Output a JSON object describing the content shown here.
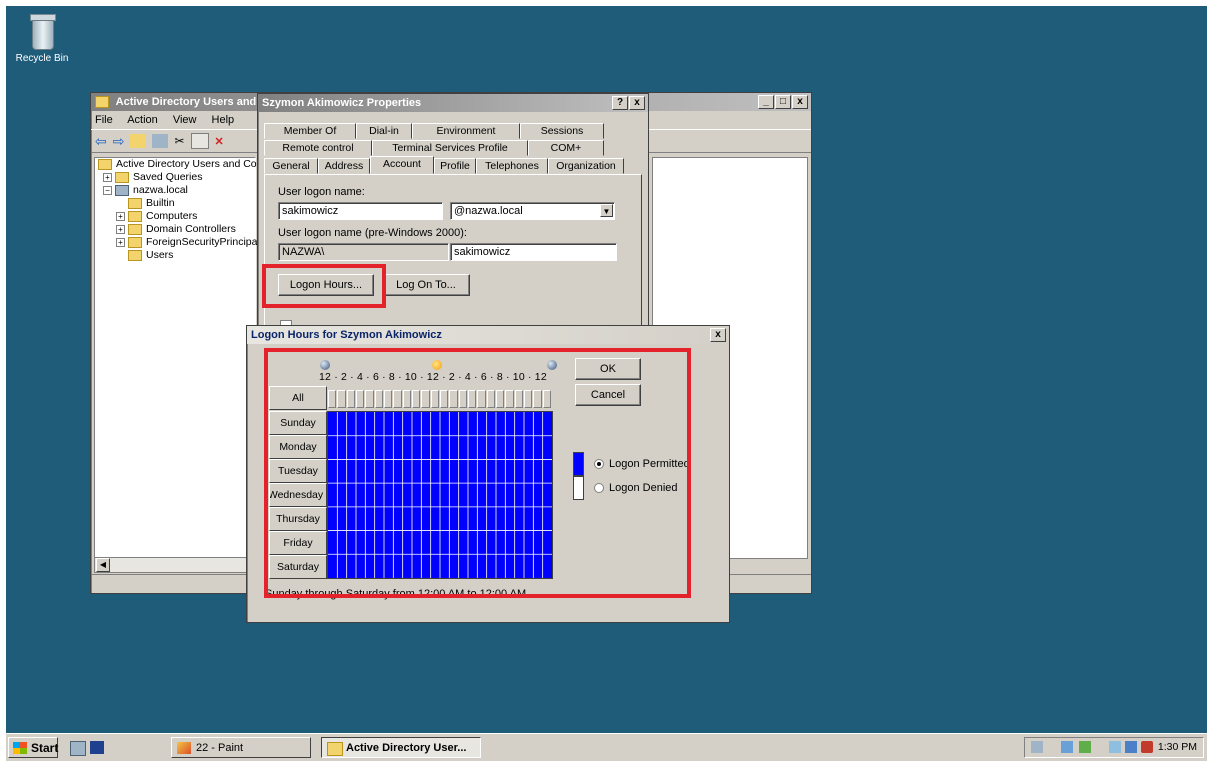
{
  "desktop": {
    "recycle_bin_label": "Recycle Bin",
    "background": "#1e5c7a"
  },
  "aduc": {
    "title": "Active Directory Users and",
    "menu": [
      "File",
      "Action",
      "View",
      "Help"
    ],
    "tree": {
      "root": "Active Directory Users and Cor",
      "saved_queries": "Saved Queries",
      "domain": "nazwa.local",
      "builtin": "Builtin",
      "computers": "Computers",
      "domain_controllers": "Domain Controllers",
      "foreign": "ForeignSecurityPrincipa",
      "users": "Users"
    }
  },
  "props": {
    "title": "Szymon Akimowicz Properties",
    "tabs_row1": [
      "Member Of",
      "Dial-in",
      "Environment",
      "Sessions"
    ],
    "tabs_row2": [
      "Remote control",
      "Terminal Services Profile",
      "COM+"
    ],
    "tabs_row3": [
      "General",
      "Address",
      "Account",
      "Profile",
      "Telephones",
      "Organization"
    ],
    "active_tab": "Account",
    "logon_name_label": "User logon name:",
    "logon_name_value": "sakimowicz",
    "domain_suffix": "@nazwa.local",
    "prewin_label": "User logon name (pre-Windows 2000):",
    "prewin_domain": "NAZWA\\",
    "prewin_user": "sakimowicz",
    "logon_hours_button": "Logon Hours...",
    "logon_to_button": "Log On To..."
  },
  "hours": {
    "title": "Logon Hours for Szymon Akimowicz",
    "time_labels": "12 · 2 · 4 · 6 · 8 · 10 · 12 · 2 · 4 · 6 · 8 · 10 · 12",
    "all_label": "All",
    "days": [
      "Sunday",
      "Monday",
      "Tuesday",
      "Wednesday",
      "Thursday",
      "Friday",
      "Saturday"
    ],
    "ok": "OK",
    "cancel": "Cancel",
    "permitted": "Logon Permitted",
    "denied": "Logon Denied",
    "permitted_color": "#0000ff",
    "status": "Sunday through Saturday from 12:00 AM to 12:00 AM",
    "permitted_selected": true
  },
  "taskbar": {
    "start": "Start",
    "paint": "22 - Paint",
    "aduc": "Active Directory User...",
    "clock": "1:30 PM"
  }
}
